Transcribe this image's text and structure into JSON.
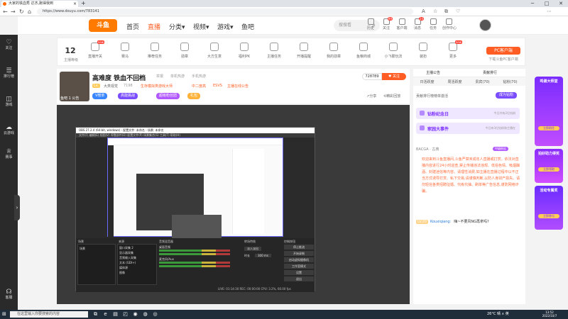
{
  "browser": {
    "tab_title": "大家的铁血秀 达杰,跑得我到",
    "new_tab": "+",
    "url": "https://www.douyu.com/783141",
    "win_min": "─",
    "win_max": "□",
    "win_close": "✕"
  },
  "site": {
    "logo_text": "斗鱼",
    "nav": [
      "首页",
      "直播",
      "分类",
      "视频",
      "游戏",
      "鱼吧"
    ],
    "search_placeholder": "搜搜看",
    "header_icons": [
      {
        "label": "历史",
        "badge": ""
      },
      {
        "label": "关注",
        "badge": "99"
      },
      {
        "label": "客户端",
        "badge": ""
      },
      {
        "label": "消息",
        "badge": "24"
      },
      {
        "label": "任务",
        "badge": ""
      },
      {
        "label": "创作中心",
        "badge": ""
      }
    ]
  },
  "sidebar": {
    "items": [
      "关注",
      "排行榜",
      "游戏",
      "云游戏",
      "赛事"
    ],
    "bottom": "客服"
  },
  "tasks": {
    "level": "12",
    "level_label": "主播等级 ",
    "items": [
      {
        "label": "直播开关",
        "new": true
      },
      {
        "label": "赛马",
        "new": false
      },
      {
        "label": "推荐任务",
        "new": false
      },
      {
        "label": "勋章",
        "new": false
      },
      {
        "label": "大方生意",
        "new": false
      },
      {
        "label": "福利PK",
        "new": false
      },
      {
        "label": "主播任务",
        "new": false
      },
      {
        "label": "开播提醒",
        "new": false
      },
      {
        "label": "我的勋章",
        "new": false
      },
      {
        "label": "鱼粮商城",
        "new": false
      },
      {
        "label": "小飞碟玩法",
        "new": false
      },
      {
        "label": "装扮",
        "new": false
      },
      {
        "label": "更多",
        "new": true
      }
    ],
    "pc_client": "PC客户端",
    "pc_sub": "下载斗鱼PC客户端"
  },
  "room": {
    "title": "高难度 铁血不回档",
    "crumbs": [
      "举报",
      "单机热游",
      "手机热游"
    ],
    "anchor": "鱼吧 1 公告",
    "follow_count": "728789",
    "follow_btn": "关注",
    "level_tag": "Lv.",
    "rank_text": "大类视觉",
    "hot": "7198",
    "tag1": "生存模拟类游戏大师",
    "tag2": "中二度高",
    "tag3": "ESVS",
    "tag4": "主播在线公告",
    "pills": [
      "V榜单",
      "高能挑战",
      "超级粉丝团",
      "礼包"
    ],
    "share": "分享",
    "report": "精彩回放"
  },
  "obs": {
    "title": "OBS 27.2.4 (64-bit, windows) - 配置文件: 未命名 - 场景: 未命名",
    "menu": "文件(F)  编辑(E)  视图(V)  停靠部件(D)  配置文件(P)  场景集合(S)  工具(T)  帮助(H)",
    "scenes_header": "场景",
    "sources_header": "来源",
    "mixer_header": "音频混音器",
    "transitions_header": "转场特效",
    "controls_header": "控制按钮",
    "scene_item": "场景",
    "sources": [
      "窗口采集 2",
      "显示器采集",
      "音频输入采集",
      "文本 (GDI+)",
      "媒体源",
      "图像"
    ],
    "mixer_items": [
      "桌面音频",
      "麦克风/Aux"
    ],
    "transition_value": "淡入淡出",
    "duration_label": "时长",
    "duration_value": "300 ms",
    "controls": [
      "停止推流",
      "开始录制",
      "启动虚拟摄像机",
      "工作室模式",
      "设置",
      "退出"
    ],
    "status": "LIVE: 01:14:30  REC: 00:00:00  CPU: 3.2%, 60.00 fps"
  },
  "chat": {
    "tabs1": [
      "主播公告",
      "贡献排行"
    ],
    "tabs2": [
      "日活跃度",
      "周活跃度",
      "贵宾(70)",
      "钻粉(70)"
    ],
    "rank_text": "贡献排行榜榜单激活",
    "rank_btn": "成为钻粉",
    "events": [
      {
        "title": "钻粉纪念日",
        "sub": "今日共有2位钻粉"
      },
      {
        "title": "家园大事件",
        "sub": "今日有3位钻粉和主播在"
      }
    ],
    "userline": "BACGA · 古典",
    "userlevel": "中级粉丝",
    "notice": "欢迎来到斗鱼直播间,斗鱼严禁未成年人直播或打赏。依法对直播内容进行24小时巡查,禁止传播违法违规、低俗色情、吸烟酗酒、封建迷信等内容。请理性消费,如主播在直播过程中以不正当方式诱导打赏、私下交易,请谨慎判断,以防人身财产损失。请勿轻信各类招聘征婚、代练代抽、刷单等广告信息,谨防网络诈骗。",
    "msg_level": "LV.20",
    "msg_nick": "Kouxiqiang:",
    "msg_text": "嗨~不要风NG再拿吗?"
  },
  "ads": [
    {
      "title": "鸣谢大师堂",
      "btn": "立即前往"
    },
    {
      "title": "拍好助力得奖",
      "btn": "立即领取"
    },
    {
      "title": "活动专属奖",
      "btn": "立即参与"
    }
  ],
  "taskbar": {
    "search": "在这里输入你要搜索的内容",
    "tray": "26°C 晴 ∧ 英",
    "time": "13:52",
    "date": "2022/10/7"
  }
}
